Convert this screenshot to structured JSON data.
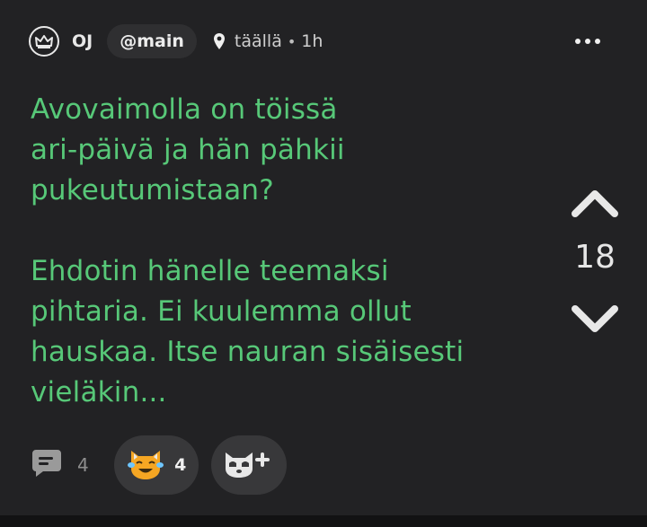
{
  "header": {
    "author": "OJ",
    "channel": "@main",
    "location": "täällä",
    "separator": "•",
    "age": "1h"
  },
  "post": {
    "text": "Avovaimolla on töissä\nari-päivä ja hän pähkii\npukeutumistaan?\n\nEhdotin hänelle teemaksi\npihtaria. Ei kuulemma ollut\nhauskaa. Itse nauran sisäisesti\nvieläkin..."
  },
  "votes": {
    "count": "18"
  },
  "footer": {
    "comment_count": "4",
    "reaction_count": "4"
  },
  "icons": {
    "avatar": "crown-icon",
    "location": "location-pin-icon",
    "more": "more-icon",
    "upvote": "chevron-up-icon",
    "downvote": "chevron-down-icon",
    "comments": "comment-bubble-icon",
    "reaction": "laughing-cat-emoji-icon",
    "add_reaction": "add-reaction-icon"
  },
  "colors": {
    "background": "#222224",
    "text_accent": "#57c878"
  }
}
